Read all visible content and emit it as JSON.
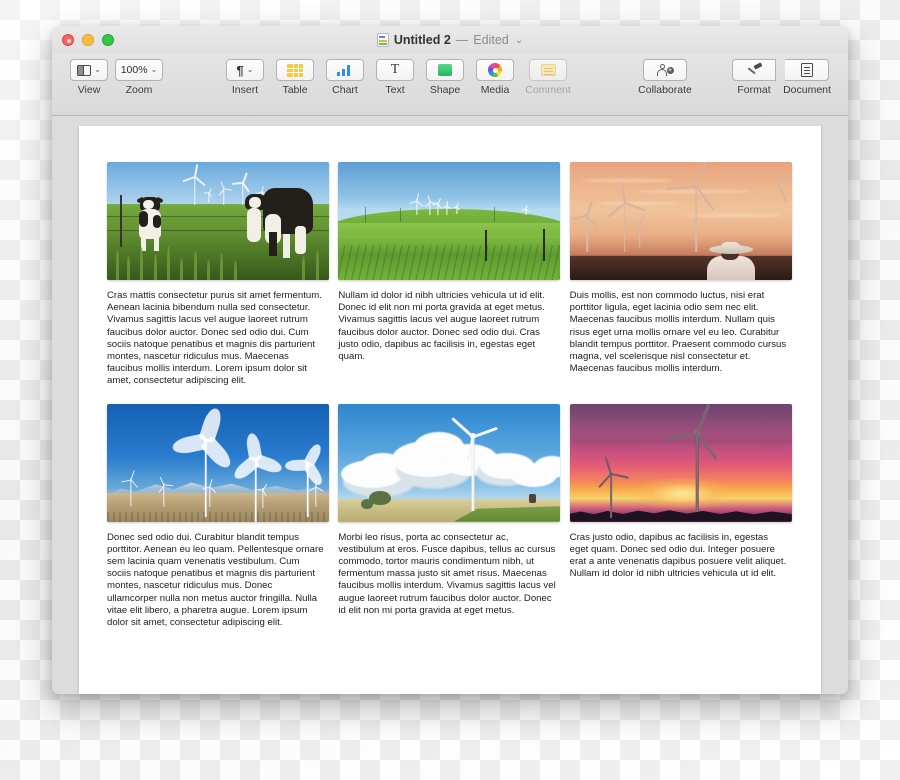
{
  "window": {
    "traffic_lights": [
      "close",
      "minimize",
      "maximize"
    ],
    "title": {
      "doc_icon": "pages-document-icon",
      "name": "Untitled 2",
      "separator": "—",
      "state": "Edited",
      "chevron": "⌄"
    }
  },
  "toolbar": {
    "items": [
      {
        "id": "view",
        "label": "View",
        "icon": "view-panel-icon",
        "has_chevron": true,
        "value": null,
        "dimmed": false
      },
      {
        "id": "zoom",
        "label": "Zoom",
        "icon": "zoom-level-icon",
        "has_chevron": true,
        "value": "100%",
        "dimmed": false
      },
      {
        "id": "insert",
        "label": "Insert",
        "icon": "pilcrow-icon",
        "has_chevron": true,
        "value": "¶",
        "dimmed": false
      },
      {
        "id": "table",
        "label": "Table",
        "icon": "table-grid-icon",
        "has_chevron": false,
        "value": null,
        "dimmed": false
      },
      {
        "id": "chart",
        "label": "Chart",
        "icon": "bar-chart-icon",
        "has_chevron": false,
        "value": null,
        "dimmed": false
      },
      {
        "id": "text",
        "label": "Text",
        "icon": "text-t-icon",
        "has_chevron": false,
        "value": "T",
        "dimmed": false
      },
      {
        "id": "shape",
        "label": "Shape",
        "icon": "green-square-icon",
        "has_chevron": false,
        "value": null,
        "dimmed": false
      },
      {
        "id": "media",
        "label": "Media",
        "icon": "photos-color-wheel-icon",
        "has_chevron": false,
        "value": null,
        "dimmed": false
      },
      {
        "id": "comment",
        "label": "Comment",
        "icon": "sticky-note-icon",
        "has_chevron": false,
        "value": null,
        "dimmed": true
      },
      {
        "id": "collaborate",
        "label": "Collaborate",
        "icon": "add-person-icon",
        "has_chevron": false,
        "value": null,
        "dimmed": false
      },
      {
        "id": "format",
        "label": "Format",
        "icon": "paintbrush-icon",
        "has_chevron": false,
        "value": null,
        "dimmed": false
      },
      {
        "id": "document",
        "label": "Document",
        "icon": "document-lines-icon",
        "has_chevron": false,
        "value": null,
        "dimmed": false
      }
    ]
  },
  "document": {
    "layout": "3-column grid, 2 rows",
    "cells": [
      {
        "image": {
          "name": "cows-grazing-with-wind-turbines",
          "alt": "Two black-and-white cows standing in tall green grass with wind turbines on the horizon under a blue sky"
        },
        "caption": "Cras mattis consectetur purus sit amet fermentum. Aenean lacinia bibendum nulla sed consectetur. Vivamus sagittis lacus vel augue laoreet rutrum faucibus dolor auctor. Donec sed odio dui. Cum sociis natoque penatibus et magnis dis parturient montes, nascetur ridiculus mus. Maecenas faucibus mollis interdum. Lorem ipsum dolor sit amet, consectetur adipiscing elit."
      },
      {
        "image": {
          "name": "green-rolling-fields-with-distant-turbines",
          "alt": "Rolling green farmland with a row of distant wind turbines on the ridge under a clear blue sky"
        },
        "caption": "Nullam id dolor id nibh ultricies vehicula ut id elit. Donec id elit non mi porta gravida at eget metus. Vivamus sagittis lacus vel augue laoreet rutrum faucibus dolor auctor. Donec sed odio dui. Cras justo odio, dapibus ac facilisis in, egestas eget quam."
      },
      {
        "image": {
          "name": "person-in-hat-watching-turbines-at-sunset",
          "alt": "Silhouette of a person wearing a wide-brimmed hat facing a wind farm in warm orange sunset light"
        },
        "caption": "Duis mollis, est non commodo luctus, nisi erat porttitor ligula, eget lacinia odio sem nec elit. Maecenas faucibus mollis interdum. Nullam quis risus eget urna mollis ornare vel eu leo. Curabitur blandit tempus porttitor. Praesent commodo cursus magna, vel scelerisque nisl consectetur et. Maecenas faucibus mollis interdum."
      },
      {
        "image": {
          "name": "turbines-spinning-over-desert-mountains",
          "alt": "White wind turbines with motion-blurred blades against a deep blue sky above snow-capped mountains and desert"
        },
        "caption": "Donec sed odio dui. Curabitur blandit tempus porttitor. Aenean eu leo quam. Pellentesque ornare sem lacinia quam venenatis vestibulum. Cum sociis natoque penatibus et magnis dis parturient montes, nascetur ridiculus mus. Donec ullamcorper nulla non metus auctor fringilla. Nulla vitae elit libero, a pharetra augue. Lorem ipsum dolor sit amet, consectetur adipiscing elit."
      },
      {
        "image": {
          "name": "single-turbine-with-cumulus-clouds",
          "alt": "A single tall wind turbine on a hill with large white cumulus clouds in a blue sky"
        },
        "caption": "Morbi leo risus, porta ac consectetur ac, vestibulum at eros. Fusce dapibus, tellus ac cursus commodo, tortor mauris condimentum nibh, ut fermentum massa justo sit amet risus. Maecenas faucibus mollis interdum. Vivamus sagittis lacus vel augue laoreet rutrum faucibus dolor auctor. Donec id elit non mi porta gravida at eget metus."
      },
      {
        "image": {
          "name": "turbine-silhouettes-magenta-sunset",
          "alt": "Two wind turbine silhouettes against a vivid magenta and gold sunset over a dark treeline"
        },
        "caption": "Cras justo odio, dapibus ac facilisis in, egestas eget quam. Donec sed odio dui. Integer posuere erat a ante venenatis dapibus posuere velit aliquet. Nullam id dolor id nibh ultricies vehicula ut id elit."
      }
    ]
  },
  "colors": {
    "titlebar": "#e4e4e4",
    "toolbar": "#dddddd",
    "canvas": "#dcdcdc",
    "page": "#ffffff",
    "close": "#fc605c",
    "minimize": "#fdbc40",
    "maximize": "#34c749",
    "table_icon": "#f6c844",
    "chart_icon": "#2b8fe0",
    "shape_icon": "#2fbd6c",
    "text": "#1d1d1d",
    "dim_text": "#a6a6a6"
  }
}
